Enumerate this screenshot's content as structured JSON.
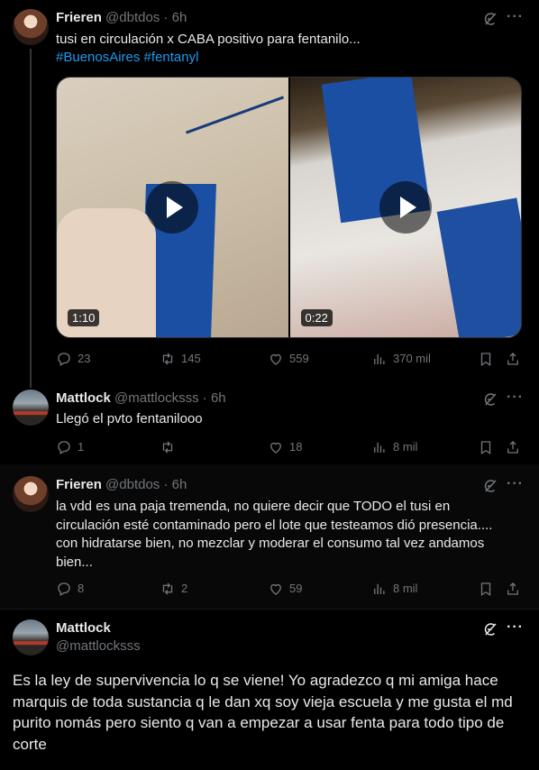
{
  "colors": {
    "background": "#000000",
    "link": "#1d9bf0",
    "muted": "#71767b",
    "text": "#e7e9ea"
  },
  "tweets": [
    {
      "name": "Frieren",
      "handle": "@dbtdos",
      "sep": "·",
      "time": "6h",
      "text": "tusi en circulación x CABA positivo para fentanilo...",
      "hashtags": "#BuenosAires #fentanyl",
      "media": [
        {
          "duration": "1:10"
        },
        {
          "duration": "0:22"
        }
      ],
      "replies": "23",
      "reposts": "145",
      "likes": "559",
      "views": "370 mil"
    },
    {
      "name": "Mattlock",
      "handle": "@mattlocksss",
      "sep": "·",
      "time": "6h",
      "text": "Llegó el pvto fentanilooo",
      "replies": "1",
      "reposts": "",
      "likes": "18",
      "views": "8 mil"
    },
    {
      "name": "Frieren",
      "handle": "@dbtdos",
      "sep": "·",
      "time": "6h",
      "text": "la vdd es una paja tremenda, no quiere decir que TODO el tusi en circulación esté contaminado pero el lote que testeamos dió presencia.... con hidratarse bien, no mezclar y moderar el consumo tal vez andamos bien...",
      "replies": "8",
      "reposts": "2",
      "likes": "59",
      "views": "8 mil"
    },
    {
      "name": "Mattlock",
      "handle": "@mattlocksss",
      "text": "Es la ley de supervivencia lo q se viene! Yo agradezco q mi amiga hace marquis de toda sustancia q le dan xq soy vieja escuela y me gusta el md purito nomás pero siento q van a empezar a usar fenta para todo tipo de corte"
    }
  ]
}
